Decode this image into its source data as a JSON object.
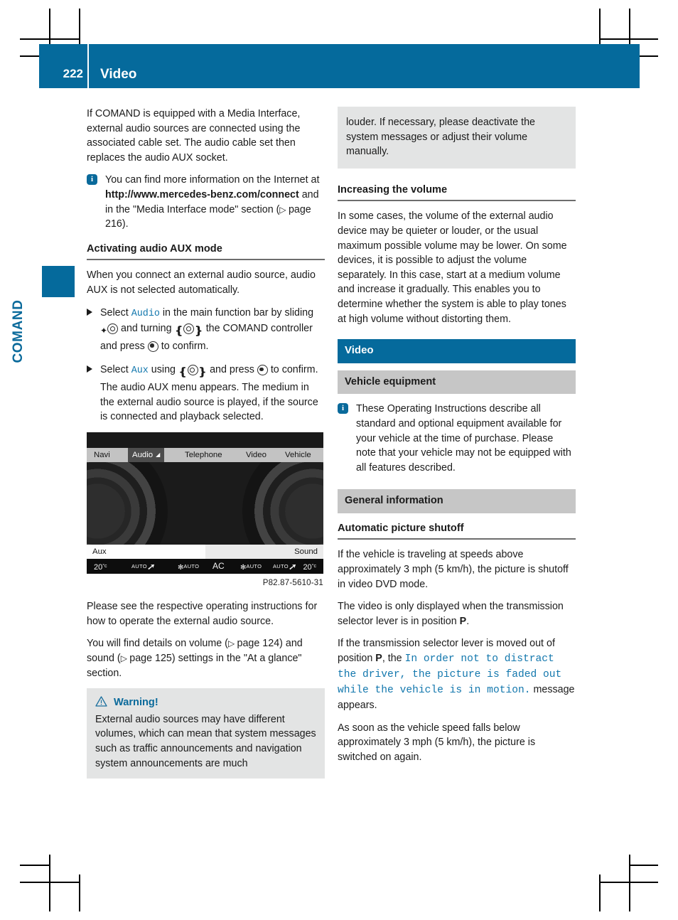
{
  "header": {
    "page_number": "222",
    "title": "Video"
  },
  "chapter_tab": {
    "label": "COMAND"
  },
  "left_column": {
    "intro_paragraph": "If COMAND is equipped with a Media Interface, external audio sources are connected using the associated cable set. The audio cable set then replaces the audio AUX socket.",
    "info_note": {
      "icon": "info-icon",
      "text_before": "You can find more information on the Internet at ",
      "bold_url": "http://www.mercedes-benz.com/connect",
      "text_after": " and in the \"Media Interface mode\" section (",
      "page_ref": "page 216",
      "text_end": ")."
    },
    "subhead": "Activating audio AUX mode",
    "lead_paragraph": "When you connect an external audio source, audio AUX is not selected automatically.",
    "steps": [
      {
        "bullet": "triangle-right-icon",
        "part1": "Select ",
        "mono1": "Audio",
        "part2": " in the main function bar by sliding ",
        "glyph1": "slide-up-controller-icon",
        "part3": " and turning ",
        "glyph2": "turn-controller-icon",
        "part4": " the COMAND controller and press ",
        "glyph3": "press-controller-icon",
        "part5": " to confirm."
      },
      {
        "bullet": "triangle-right-icon",
        "part1": "Select ",
        "mono1": "Aux",
        "part2": " using ",
        "glyph2": "turn-controller-icon",
        "part3": " and press ",
        "glyph3": "press-controller-icon",
        "part4": " to confirm.",
        "detail": "The audio AUX menu appears. The medium in the external audio source is played, if the source is connected and playback selected."
      }
    ],
    "comand_screen": {
      "menu_items": [
        "Navi",
        "Audio",
        "Telephone",
        "Video",
        "Vehicle"
      ],
      "selected_menu_item": "Audio",
      "dropdown_indicator": "dropdown-arrow-icon",
      "softkey_left": "Aux",
      "softkey_right": "Sound",
      "climate_bar": {
        "temp_left": "20",
        "temp_left_unit": "°c",
        "auto_left": "AUTO",
        "fan_left": "AUTO",
        "ac": "AC",
        "fan_right": "AUTO",
        "auto_right": "AUTO",
        "temp_right": "20",
        "temp_right_unit": "°c"
      }
    },
    "figure_caption": "P82.87-5610-31",
    "after_figure_paragraph": "Please see the respective operating instructions for how to operate the external audio source.",
    "settings_paragraph": {
      "part1": "You will find details on volume (",
      "page_ref_1": "page 124",
      "part2": ") and sound (",
      "page_ref_2": "page 125",
      "part3": ") settings in the \"At a glance\" section."
    },
    "warning_box": {
      "icon": "warning-triangle-icon",
      "title": "Warning!",
      "body": "External audio sources may have different volumes, which can mean that system messages such as traffic announcements and navigation system announcements are much"
    }
  },
  "right_column": {
    "warning_continuation": "louder. If necessary, please deactivate the system messages or adjust their volume manually.",
    "subhead_increasing_volume": "Increasing the volume",
    "increasing_volume_body": "In some cases, the volume of the external audio device may be quieter or louder, or the usual maximum possible volume may be lower. On some devices, it is possible to adjust the volume separately. In this case, start at a medium volume and increase it gradually. This enables you to determine whether the system is able to play tones at high volume without distorting them.",
    "section_bar_video": "Video",
    "section_bar_vehicle_equipment": "Vehicle equipment",
    "vehicle_equipment_note": {
      "icon": "info-icon",
      "text": "These Operating Instructions describe all standard and optional equipment available for your vehicle at the time of purchase. Please note that your vehicle may not be equipped with all features described."
    },
    "section_bar_general_information": "General information",
    "subhead_automatic_picture_shutoff": "Automatic picture shutoff",
    "shutoff_paragraph": "If the vehicle is traveling at speeds above approximately  3 mph (5 km/h), the picture is shutoff in video DVD mode.",
    "displayed_paragraph": {
      "part1": "The video is only displayed when the transmission selector lever is in position ",
      "bold1": "P",
      "part2": "."
    },
    "message_paragraph": {
      "part1": "If the transmission selector lever is moved out of position ",
      "bold1": "P",
      "part2": ", the ",
      "message": "In order not to distract the driver, the picture is faded out while the vehicle is in motion.",
      "part3": " message appears."
    },
    "speed_paragraph": "As soon as the vehicle speed falls below approximately 3 mph (5 km/h), the picture is switched on again."
  },
  "colors": {
    "brand_blue": "#056a9c",
    "link_blue": "#1277ad",
    "gray_bar": "#c6c6c6",
    "caution_gray": "#e3e4e4"
  }
}
